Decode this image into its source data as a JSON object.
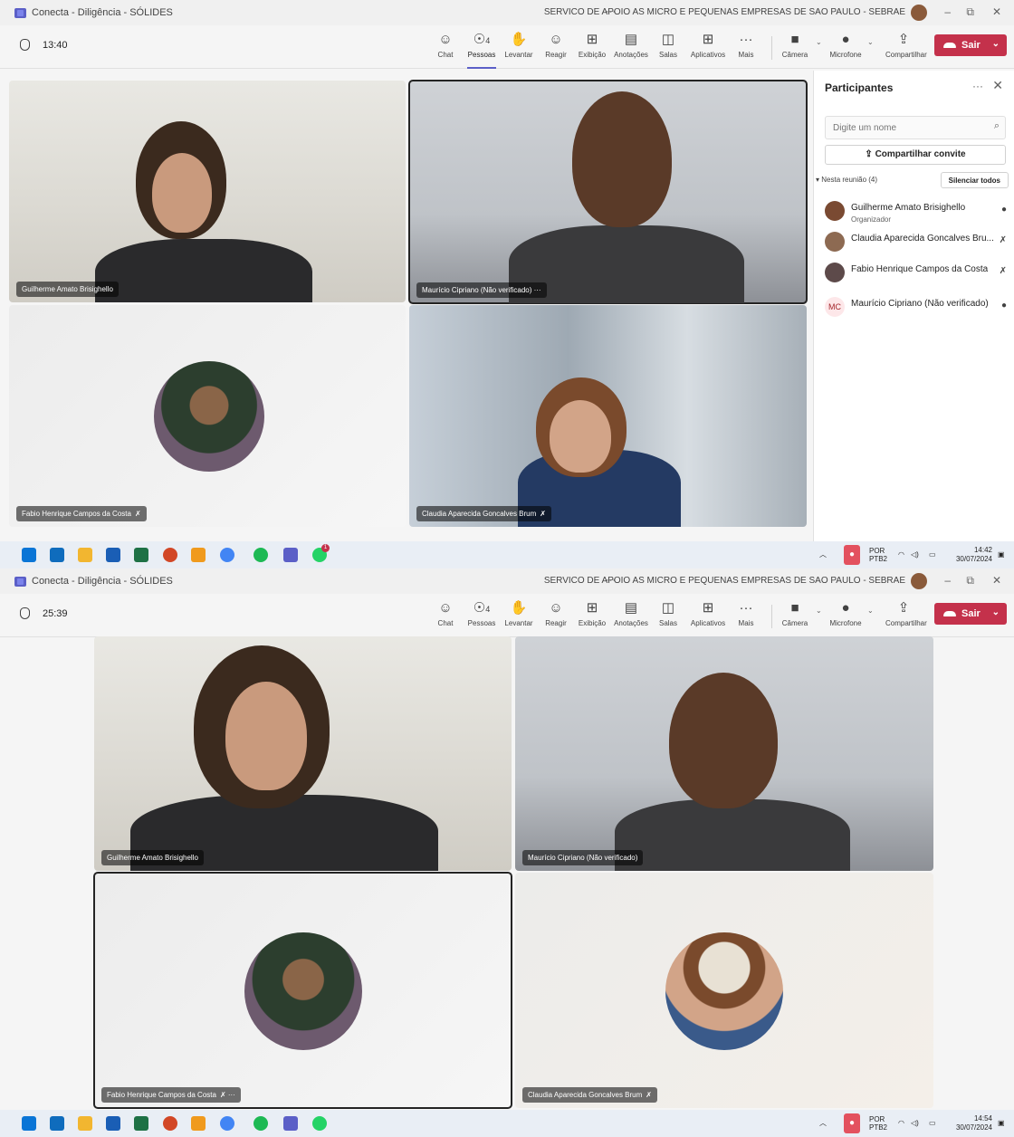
{
  "window": {
    "title": "Conecta - Diligência - SÓLIDES",
    "org_name": "SERVICO DE APOIO AS MICRO E PEQUENAS EMPRESAS DE SAO PAULO - SEBRAE",
    "more_label": "···",
    "minimize": "–",
    "restore": "⧉",
    "close": "✕"
  },
  "toolbar": {
    "chat": "Chat",
    "people": "Pessoas",
    "people_count": "4",
    "raise": "Levantar",
    "react": "Reagir",
    "view": "Exibição",
    "notes": "Anotações",
    "rooms": "Salas",
    "apps": "Aplicativos",
    "more": "Mais",
    "camera": "Câmera",
    "mic": "Microfone",
    "share": "Compartilhar",
    "leave": "Sair"
  },
  "icons": {
    "chat": "☺",
    "people": "☉",
    "raise": "✋",
    "react": "☺",
    "view": "⊞",
    "notes": "▤",
    "rooms": "◫",
    "apps": "⊞",
    "more": "···",
    "camera": "■",
    "mic": "●",
    "share": "⇪"
  },
  "screen1": {
    "timer": "13:40",
    "tiles": [
      {
        "name": "Guilherme Amato Brisighello",
        "muted": false
      },
      {
        "name": "Maurício Cipriano (Não verificado) ···",
        "muted": false
      },
      {
        "name": "Fabio Henrique Campos da Costa",
        "muted": true
      },
      {
        "name": "Claudia Aparecida Goncalves Brum",
        "muted": true
      }
    ],
    "panel": {
      "title": "Participantes",
      "search_placeholder": "Digite um nome",
      "invite": "Compartilhar convite",
      "section": "▾ Nesta reunião (4)",
      "mute_all": "Silenciar todos",
      "participants": [
        {
          "name": "Guilherme Amato Brisighello",
          "role": "Organizador",
          "mic": "on"
        },
        {
          "name": "Claudia Aparecida Goncalves Bru...",
          "role": "",
          "mic": "off"
        },
        {
          "name": "Fabio Henrique Campos da Costa",
          "role": "",
          "mic": "off"
        },
        {
          "name": "Maurício Cipriano (Não verificado)",
          "role": "",
          "mic": "on",
          "initials": "MC"
        }
      ]
    },
    "taskbar": {
      "lang": "POR",
      "layout": "PTB2",
      "time": "14:42",
      "date": "30/07/2024",
      "whatsapp_badge": "1"
    }
  },
  "screen2": {
    "timer": "25:39",
    "tiles": [
      {
        "name": "Guilherme Amato Brisighello",
        "muted": false
      },
      {
        "name": "Maurício Cipriano (Não verificado)",
        "muted": false
      },
      {
        "name": "Fabio Henrique Campos da Costa",
        "muted": true,
        "more": "···"
      },
      {
        "name": "Claudia Aparecida Goncalves Brum",
        "muted": true
      }
    ],
    "taskbar": {
      "lang": "POR",
      "layout": "PTB2",
      "time": "14:54",
      "date": "30/07/2024"
    }
  },
  "colors": {
    "accent": "#5b5fc7",
    "leave": "#c4314b",
    "mic_indicator": "#e3515f"
  }
}
